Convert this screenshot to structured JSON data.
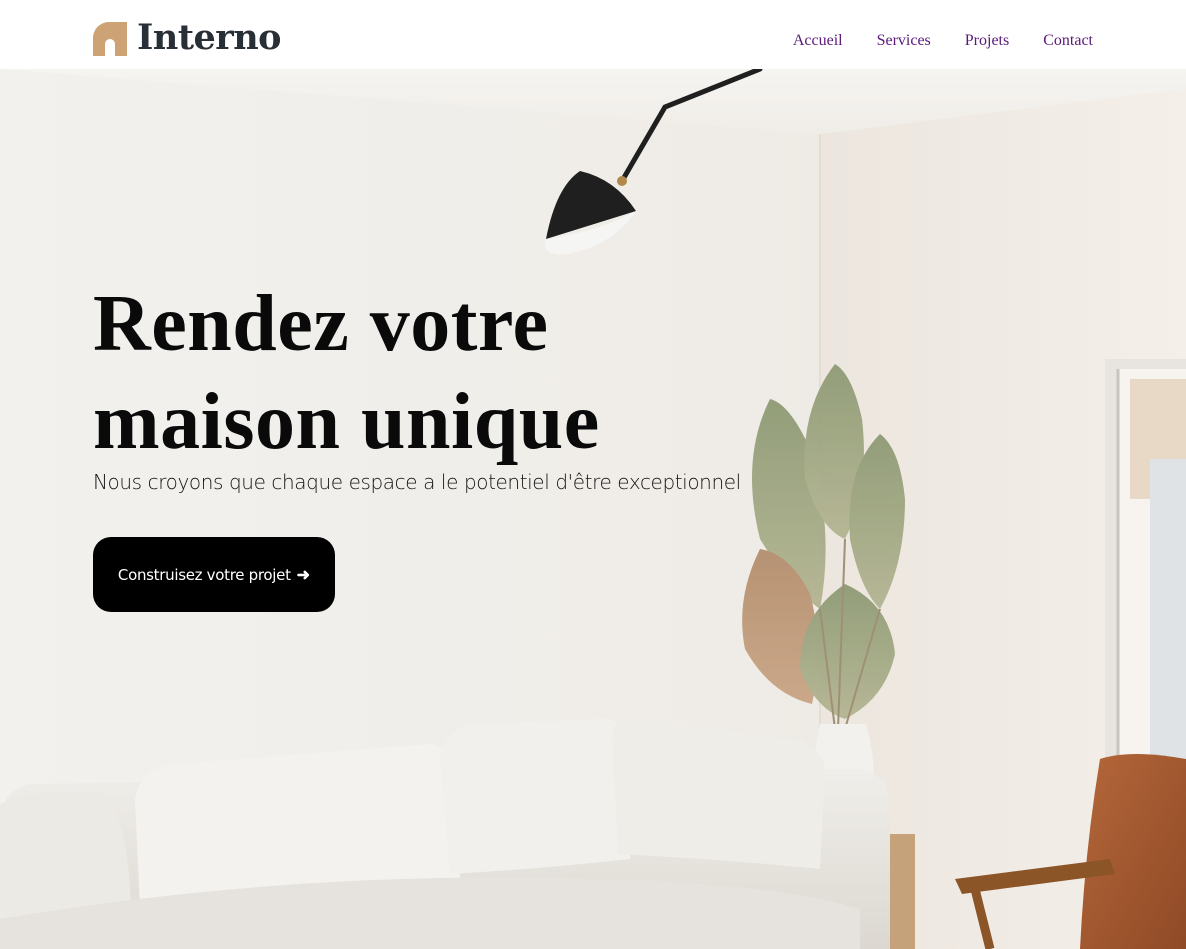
{
  "brand": {
    "name": "Interno",
    "icon": "arch-logo-icon",
    "accent_color": "#CDA274",
    "text_color": "#292F36"
  },
  "nav": {
    "items": [
      {
        "label": "Accueil"
      },
      {
        "label": "Services"
      },
      {
        "label": "Projets"
      },
      {
        "label": "Contact"
      }
    ],
    "link_color": "#5a1a7a"
  },
  "hero": {
    "title_line1": "Rendez votre",
    "title_line2": "maison unique",
    "subtitle": "Nous croyons que chaque espace a le potentiel d'être exceptionnel",
    "cta_label": "Construisez votre projet",
    "cta_icon": "arrow-right-icon",
    "cta_arrow": "➜",
    "background_image": "living-room-photo"
  }
}
